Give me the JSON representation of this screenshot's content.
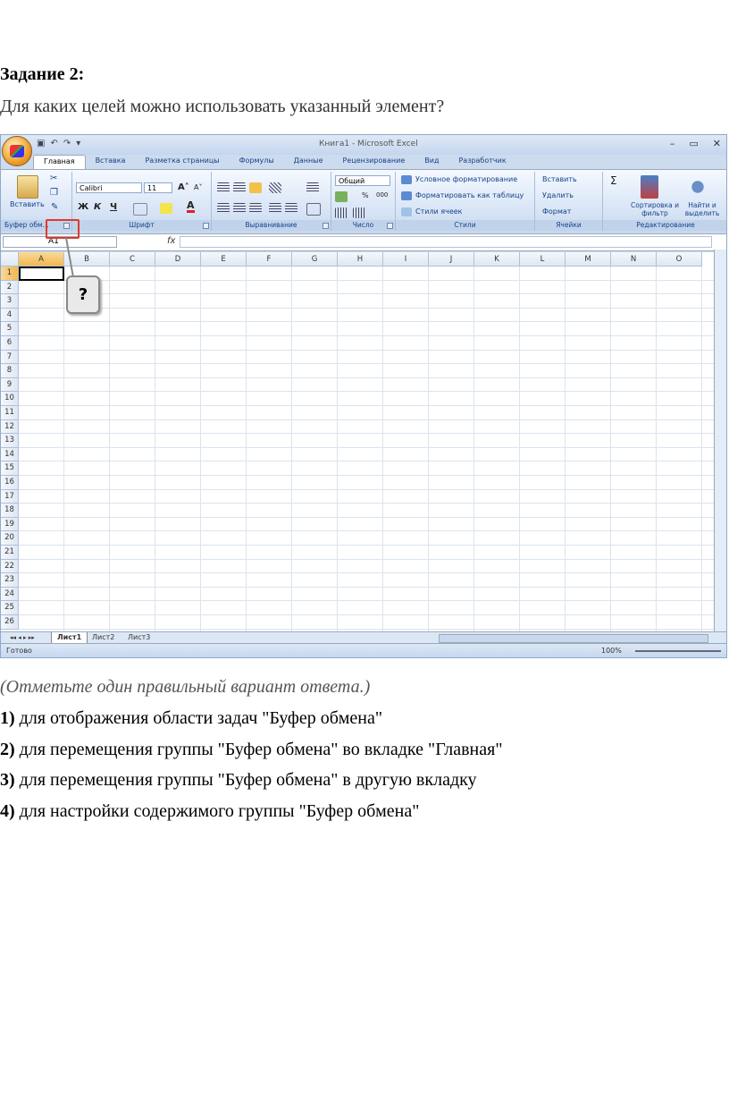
{
  "task": {
    "title": "Задание 2:",
    "question": "Для каких целей можно использовать указанный элемент?",
    "note": "(Отметьте один правильный вариант ответа.)",
    "options": [
      {
        "num": "1)",
        "text": " для отображения области задач \"Буфер обмена\""
      },
      {
        "num": "2)",
        "text": " для перемещения группы \"Буфер обмена\" во вкладке \"Главная\""
      },
      {
        "num": "3)",
        "text": " для перемещения группы \"Буфер обмена\" в другую вкладку"
      },
      {
        "num": "4)",
        "text": " для настройки содержимого группы \"Буфер обмена\""
      }
    ],
    "callout_mark": "?"
  },
  "excel": {
    "window_title": "Книга1 - Microsoft Excel",
    "window_controls": [
      "–",
      "▭",
      "✕"
    ],
    "tabs": [
      "Главная",
      "Вставка",
      "Разметка страницы",
      "Формулы",
      "Данные",
      "Рецензирование",
      "Вид",
      "Разработчик"
    ],
    "groups": {
      "clipboard": {
        "label": "Буфер обм...",
        "paste": "Вставить"
      },
      "font": {
        "label": "Шрифт",
        "font_name": "Calibri",
        "font_size": "11",
        "bold": "Ж",
        "italic": "К",
        "underline": "Ч",
        "grow": "A˄",
        "shrink": "A˅",
        "color": "A"
      },
      "alignment": {
        "label": "Выравнивание"
      },
      "number": {
        "label": "Число",
        "format": "Общий",
        "percent": "%",
        "thousands": "000"
      },
      "styles": {
        "label": "Стили",
        "conditional": "Условное форматирование",
        "as_table": "Форматировать как таблицу",
        "cell_styles": "Стили ячеек"
      },
      "cells": {
        "label": "Ячейки",
        "insert": "Вставить",
        "delete": "Удалить",
        "format": "Формат"
      },
      "editing": {
        "label": "Редактирование",
        "sigma": "Σ",
        "sort": "Сортировка и фильтр",
        "find": "Найти и выделить"
      }
    },
    "name_box": "A1",
    "fx": "fx",
    "columns": [
      "A",
      "B",
      "C",
      "D",
      "E",
      "F",
      "G",
      "H",
      "I",
      "J",
      "K",
      "L",
      "M",
      "N",
      "O"
    ],
    "rows": [
      "1",
      "2",
      "3",
      "4",
      "5",
      "6",
      "7",
      "8",
      "9",
      "10",
      "11",
      "12",
      "13",
      "14",
      "15",
      "16",
      "17",
      "18",
      "19",
      "20",
      "21",
      "22",
      "23",
      "24",
      "25",
      "26"
    ],
    "sheets": [
      "Лист1",
      "Лист2",
      "Лист3"
    ],
    "status": "Готово",
    "zoom": "100%"
  }
}
